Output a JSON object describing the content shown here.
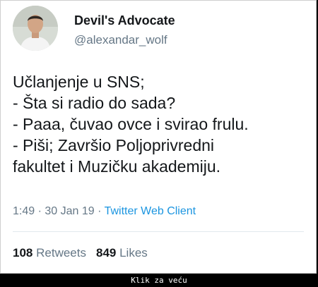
{
  "author": {
    "name": "Devil's Advocate",
    "handle": "@alexandar_wolf"
  },
  "tweet": {
    "lines": [
      "Učlanjenje u SNS;",
      "- Šta si radio do sada?",
      "- Paaa, čuvao ovce i svirao frulu.",
      "- Piši; Završio Poljoprivredni",
      "fakultet i Muzičku akademiju."
    ],
    "time": "1:49",
    "sep1": " · ",
    "date": "30 Jan 19",
    "sep2": " · ",
    "client": "Twitter Web Client"
  },
  "stats": {
    "retweets_count": "108",
    "retweets_label": "Retweets",
    "likes_count": "849",
    "likes_label": "Likes"
  },
  "footer": {
    "text": "Klik za veću"
  },
  "colors": {
    "text": "#14171a",
    "muted": "#657786",
    "link": "#1b95e0",
    "background": "#ffffff",
    "frame": "#000000"
  }
}
